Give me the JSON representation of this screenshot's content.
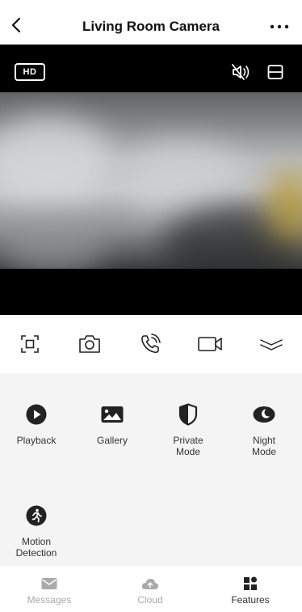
{
  "header": {
    "title": "Living Room Camera",
    "back_icon": "chevron-left-icon",
    "more_icon": "ellipsis-icon"
  },
  "video": {
    "quality_label": "HD",
    "mute_icon": "speaker-muted-icon",
    "layout_icon": "layout-toggle-icon"
  },
  "controls": [
    {
      "icon": "screenshot-frame-icon"
    },
    {
      "icon": "camera-icon"
    },
    {
      "icon": "phone-call-icon"
    },
    {
      "icon": "video-record-icon"
    },
    {
      "icon": "collapse-chevron-icon"
    }
  ],
  "features": [
    {
      "label": "Playback",
      "icon": "play-circle-icon"
    },
    {
      "label": "Gallery",
      "icon": "image-icon"
    },
    {
      "label": "Private\nMode",
      "icon": "shield-icon"
    },
    {
      "label": "Night\nMode",
      "icon": "moon-icon"
    },
    {
      "label": "Motion\nDetection",
      "icon": "running-person-icon"
    }
  ],
  "tabs": [
    {
      "label": "Messages",
      "icon": "envelope-icon",
      "active": false
    },
    {
      "label": "Cloud",
      "icon": "cloud-icon",
      "active": false
    },
    {
      "label": "Features",
      "icon": "grid-icon",
      "active": true
    }
  ],
  "colors": {
    "accent": "#222222",
    "inactive": "#aaaaaa",
    "panel_bg": "#f4f4f4"
  }
}
